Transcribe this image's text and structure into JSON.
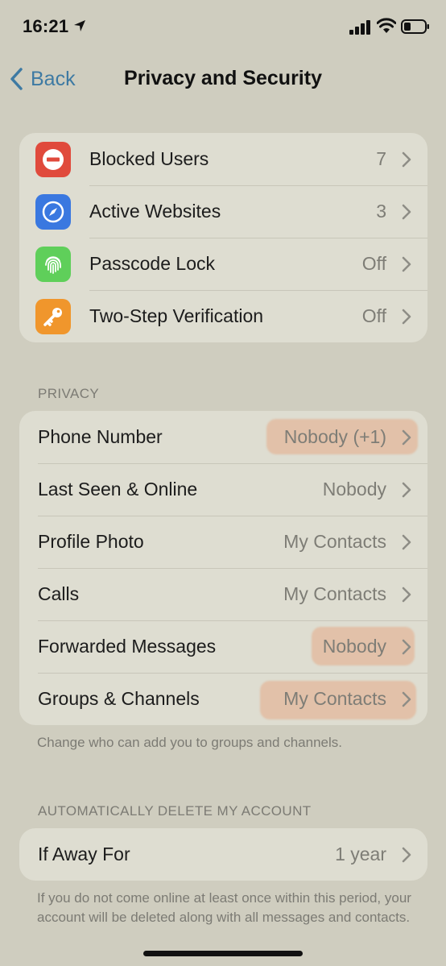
{
  "status_bar": {
    "time": "16:21"
  },
  "nav": {
    "back_label": "Back",
    "title": "Privacy and Security"
  },
  "security": {
    "items": [
      {
        "label": "Blocked Users",
        "value": "7",
        "icon": "blocked-icon",
        "color": "#e04a3c"
      },
      {
        "label": "Active Websites",
        "value": "3",
        "icon": "compass-icon",
        "color": "#3a78e0"
      },
      {
        "label": "Passcode Lock",
        "value": "Off",
        "icon": "fingerprint-icon",
        "color": "#5fcf5a"
      },
      {
        "label": "Two-Step Verification",
        "value": "Off",
        "icon": "key-icon",
        "color": "#f0962c"
      }
    ]
  },
  "privacy": {
    "header": "PRIVACY",
    "items": [
      {
        "label": "Phone Number",
        "value": "Nobody (+1)"
      },
      {
        "label": "Last Seen & Online",
        "value": "Nobody"
      },
      {
        "label": "Profile Photo",
        "value": "My Contacts"
      },
      {
        "label": "Calls",
        "value": "My Contacts"
      },
      {
        "label": "Forwarded Messages",
        "value": "Nobody"
      },
      {
        "label": "Groups & Channels",
        "value": "My Contacts"
      }
    ],
    "footer": "Change who can add you to groups and channels."
  },
  "delete_account": {
    "header": "AUTOMATICALLY DELETE MY ACCOUNT",
    "label": "If Away For",
    "value": "1 year",
    "footer": "If you do not come online at least once within this period, your account will be deleted along with all messages and contacts."
  },
  "colors": {
    "accent": "#3e7aa3",
    "highlight": "#e6a078"
  }
}
